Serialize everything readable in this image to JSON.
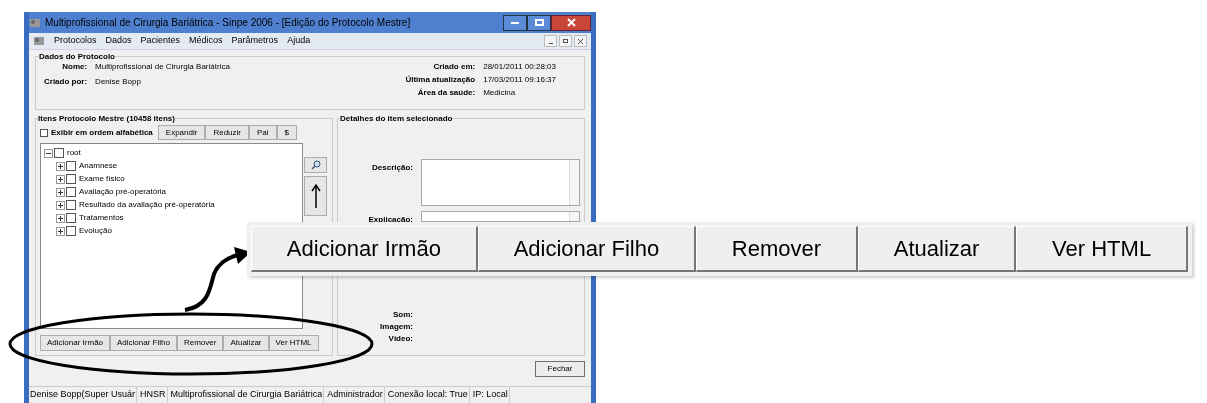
{
  "window": {
    "title": "Multiprofissional de Cirurgia Bariátrica - Sinpe 2006 - [Edição do Protocolo Mestre]"
  },
  "menu": [
    "Protocolos",
    "Dados",
    "Pacientes",
    "Médicos",
    "Parâmetros",
    "Ajuda"
  ],
  "protocol": {
    "title": "Dados do Protocolo",
    "fields_left": [
      {
        "label": "Nome:",
        "value": "Multiprofissional de Cirurgia Bariátrica"
      },
      {
        "label": "Criado por:",
        "value": "Denise Bopp"
      }
    ],
    "fields_right": [
      {
        "label": "Criado em:",
        "value": "28/01/2011 00:28:03"
      },
      {
        "label": "Última atualização",
        "value": "17/03/2011 09:16:37"
      },
      {
        "label": "Área da saúde:",
        "value": "Medicina"
      }
    ]
  },
  "items_panel": {
    "title": "Itens Protocolo Mestre (10458 itens)",
    "sort_checkbox": {
      "label": "Exibir em ordem alfabética",
      "checked": false
    },
    "tool_buttons": [
      "Expandir",
      "Reduzir",
      "Pai",
      "$"
    ],
    "tree": {
      "label": "root",
      "checked": false,
      "expanded": true,
      "children": [
        {
          "label": "Anamnese",
          "checked": false,
          "expanded": false
        },
        {
          "label": "Exame físico",
          "checked": false,
          "expanded": false
        },
        {
          "label": "Avaliação pré-operatória",
          "checked": false,
          "expanded": false
        },
        {
          "label": "Resultado da avaliação pré-operatória",
          "checked": false,
          "expanded": false
        },
        {
          "label": "Tratamentos",
          "checked": false,
          "expanded": false
        },
        {
          "label": "Evolução",
          "checked": false,
          "expanded": false
        }
      ]
    },
    "action_buttons": [
      "Adicionar Irmão",
      "Adicionar Filho",
      "Remover",
      "Atualizar",
      "Ver HTML"
    ]
  },
  "details_panel": {
    "title": "Detalhes do item selecionado",
    "fields": [
      {
        "label": "Descrição:",
        "kind": "textarea"
      },
      {
        "label": "Explicação:",
        "kind": "textarea"
      },
      {
        "label": "Som:",
        "kind": "label"
      },
      {
        "label": "Imagem:",
        "kind": "label"
      },
      {
        "label": "Vídeo:",
        "kind": "label"
      }
    ]
  },
  "close_button": "Fechar",
  "status_bar": [
    "Denise Bopp(Super Usuár",
    "HNSR",
    "Multiprofissional de Cirurgia Bariátrica",
    "Administrador",
    "Conexão local: True",
    "IP: Local"
  ],
  "callout": {
    "buttons": [
      "Adicionar Irmão",
      "Adicionar Filho",
      "Remover",
      "Atualizar",
      "Ver HTML"
    ]
  }
}
